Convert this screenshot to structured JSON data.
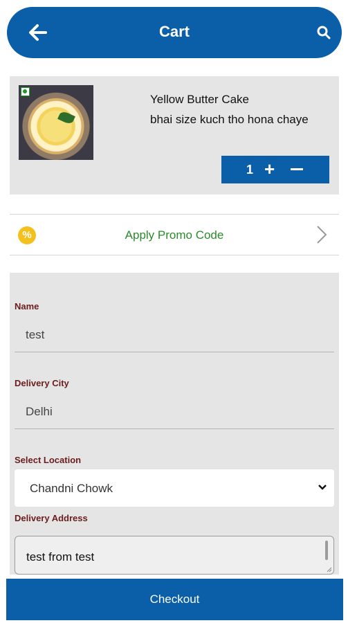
{
  "header": {
    "title": "Cart",
    "back_icon": "arrow-left-icon",
    "search_icon": "search-icon",
    "color": "#0a5fa8"
  },
  "cart_item": {
    "name": "Yellow Butter Cake",
    "note": "bhai size kuch tho hona chaye",
    "quantity": "1",
    "plus_label": "+",
    "image_icon": "cake-image",
    "veg_icon": "veg-mark-icon"
  },
  "promo": {
    "label": "Apply Promo Code",
    "icon_text": "%",
    "label_color": "#2a8a2a"
  },
  "form": {
    "name_label": "Name",
    "name_value": "test",
    "city_label": "Delivery City",
    "city_value": "Delhi",
    "location_label": "Select Location",
    "location_value": "Chandni Chowk",
    "address_label": "Delivery Address",
    "address_value": "test from test"
  },
  "checkout": {
    "label": "Checkout"
  }
}
